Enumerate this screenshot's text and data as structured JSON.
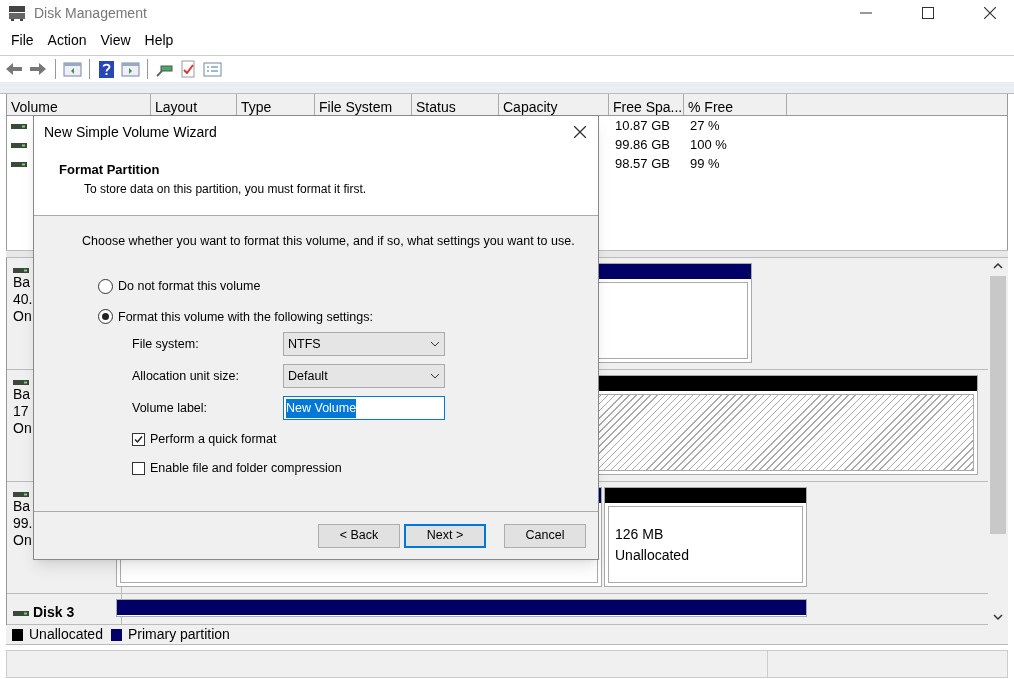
{
  "window": {
    "title": "Disk Management"
  },
  "menu": [
    "File",
    "Action",
    "View",
    "Help"
  ],
  "volume_table": {
    "columns": [
      "Volume",
      "Layout",
      "Type",
      "File System",
      "Status",
      "Capacity",
      "Free Spa...",
      "% Free"
    ],
    "rows": [
      {
        "free_space": "10.87 GB",
        "percent_free": "27 %"
      },
      {
        "free_space": "99.86 GB",
        "percent_free": "100 %"
      },
      {
        "free_space": "98.57 GB",
        "percent_free": "99 %"
      }
    ]
  },
  "disks": [
    {
      "lines": [
        "Ba",
        "40.",
        "On"
      ],
      "partitions": [
        {
          "kind": "primary"
        }
      ]
    },
    {
      "lines": [
        "Ba",
        "17",
        "On"
      ],
      "partitions": [
        {
          "kind": "unallocated"
        }
      ]
    },
    {
      "lines": [
        "Ba",
        "99.",
        "On"
      ],
      "partitions": [
        {
          "kind": "primary"
        },
        {
          "kind": "unallocated",
          "size": "126 MB",
          "label": "Unallocated"
        }
      ]
    },
    {
      "name": "Disk 3",
      "partitions": [
        {
          "kind": "primary"
        }
      ]
    }
  ],
  "legend": [
    {
      "label": "Unallocated",
      "color": "#000000"
    },
    {
      "label": "Primary partition",
      "color": "#000066"
    }
  ],
  "dialog": {
    "title": "New Simple Volume Wizard",
    "heading": "Format Partition",
    "subheading": "To store data on this partition, you must format it first.",
    "instruction": "Choose whether you want to format this volume, and if so, what settings you want to use.",
    "options": [
      {
        "label": "Do not format this volume",
        "selected": false
      },
      {
        "label": "Format this volume with the following settings:",
        "selected": true
      }
    ],
    "fields": [
      {
        "kind": "dropdown",
        "label": "File system:",
        "value": "NTFS"
      },
      {
        "kind": "dropdown",
        "label": "Allocation unit size:",
        "value": "Default"
      },
      {
        "kind": "text",
        "label": "Volume label:",
        "value": "New Volume",
        "focused": true
      }
    ],
    "checkboxes": [
      {
        "label": "Perform a quick format",
        "checked": true
      },
      {
        "label": "Enable file and folder compression",
        "checked": false
      }
    ],
    "buttons": [
      {
        "label": "< Back",
        "default": false
      },
      {
        "label": "Next >",
        "default": true
      },
      {
        "label": "Cancel",
        "default": false
      }
    ]
  }
}
